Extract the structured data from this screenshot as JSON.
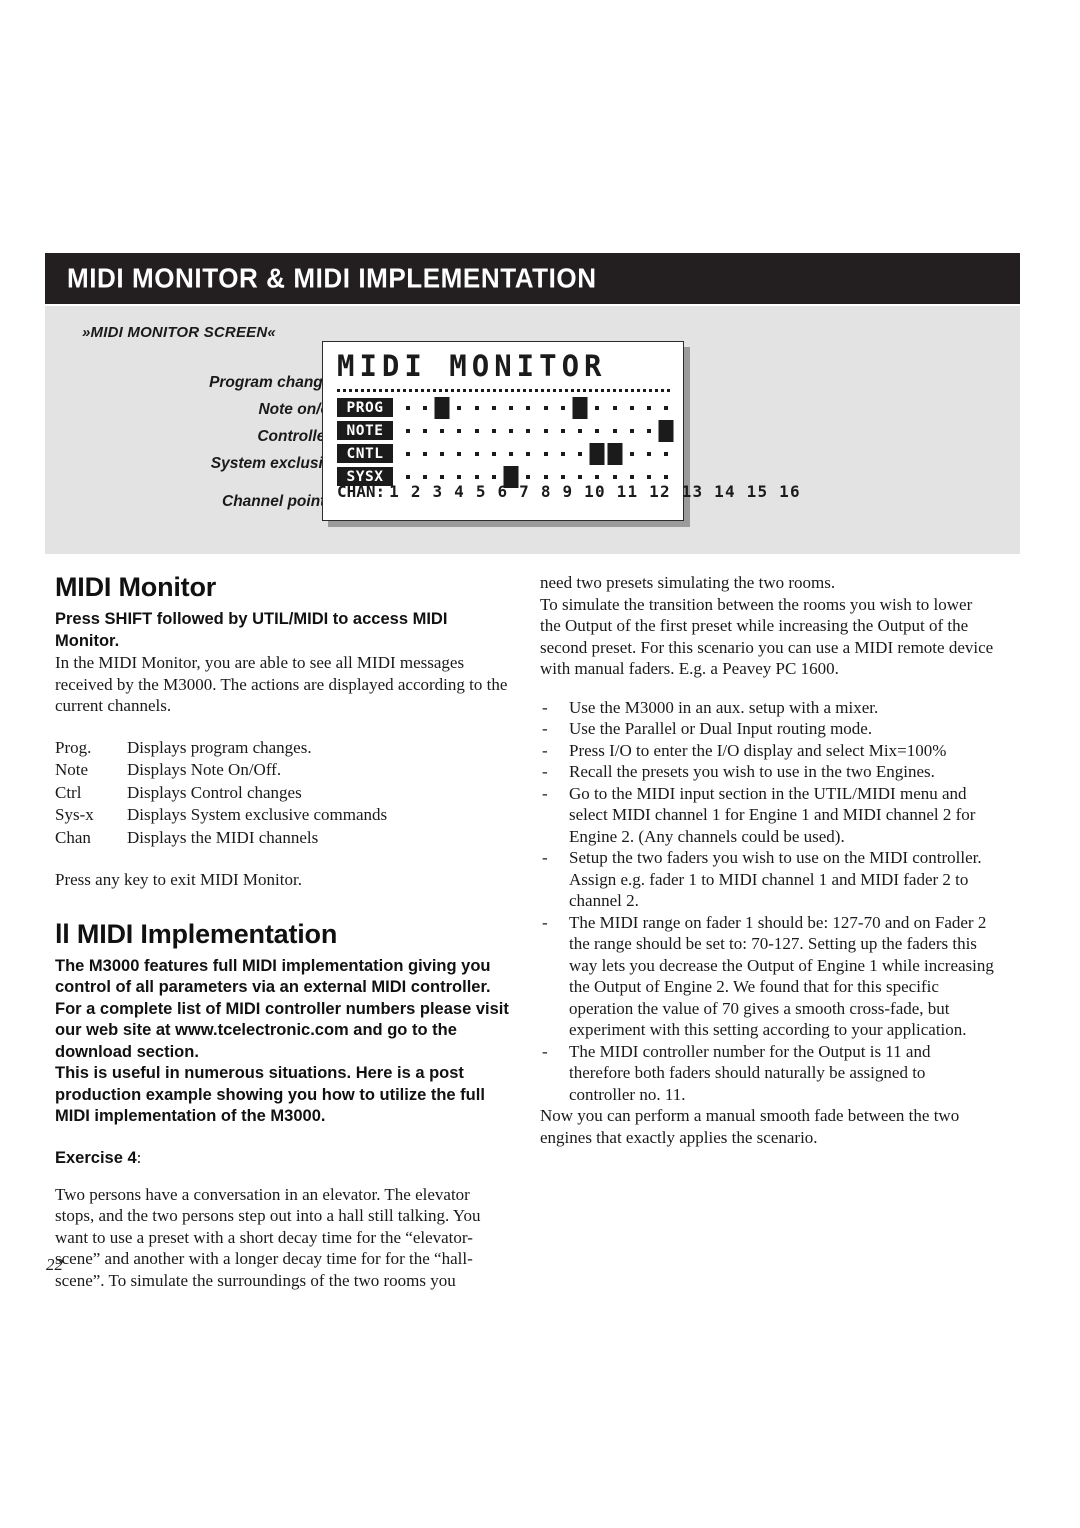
{
  "header": {
    "title": "MIDI MONITOR  &  MIDI IMPLEMENTATION",
    "background_color": "#231f20",
    "text_color": "#ffffff"
  },
  "figure": {
    "caption": "»MIDI MONITOR SCREEN«",
    "panel_color": "#e3e3e3",
    "callouts": [
      {
        "label": "Program changes",
        "target_row": "PROG"
      },
      {
        "label": "Note on/off",
        "target_row": "NOTE"
      },
      {
        "label": "Controllers",
        "target_row": "CNTL"
      },
      {
        "label": "System exclusive",
        "target_row": "SYSX"
      },
      {
        "label": "Channel pointer",
        "target_row": "CHAN"
      }
    ],
    "lcd": {
      "title": "MIDI MONITOR",
      "channel_label": "CHAN:",
      "channel_numbers": "1 2 3 4 5 6 7 8 9 10 11 12 13 14 15 16",
      "channel_count": 16,
      "rows": [
        {
          "tag": "PROG",
          "active_channels": [
            3,
            11
          ]
        },
        {
          "tag": "NOTE",
          "active_channels": [
            16
          ]
        },
        {
          "tag": "CNTL",
          "active_channels": [
            12,
            13
          ]
        },
        {
          "tag": "SYSX",
          "active_channels": [
            7
          ]
        }
      ]
    }
  },
  "left_column": {
    "heading": "MIDI Monitor",
    "intro_bold": "Press SHIFT followed by UTIL/MIDI to access MIDI Monitor.",
    "intro_body": "In the MIDI Monitor, you are able to see all MIDI messages received by the M3000. The actions are displayed according to the current channels.",
    "definitions": [
      {
        "term": "Prog.",
        "description": "Displays program changes."
      },
      {
        "term": "Note",
        "description": "Displays Note On/Off."
      },
      {
        "term": "Ctrl",
        "description": "Displays Control changes"
      },
      {
        "term": "Sys-x",
        "description": "Displays System exclusive commands"
      },
      {
        "term": "Chan",
        "description": "Displays the MIDI channels"
      }
    ],
    "exit_note": "Press any key to exit MIDI Monitor.",
    "heading2": "ll MIDI Implementation",
    "impl_bold_1": "The M3000 features full MIDI implementation giving you control of all parameters via an external MIDI controller.",
    "impl_bold_2": "For a complete list of MIDI controller numbers please visit our web site at www.tcelectronic.com and go to the download section.",
    "impl_bold_3": "This is useful in numerous situations. Here is a post production example showing you how to utilize the full MIDI implementation of the M3000.",
    "exercise_label": "Exercise 4",
    "exercise_colon": ":",
    "exercise_body": "Two persons have a conversation in an elevator. The elevator stops, and the two persons step out into a hall still talking. You want to use a preset with a short decay time for the “elevator-scene” and another with a longer decay time for for the “hall-scene”. To simulate the surroundings of the two rooms you"
  },
  "right_column": {
    "continuation": "need two presets simulating the two rooms.",
    "paragraph_1": "To simulate the transition between the rooms you wish to lower the Output of the first preset while increasing the Output of the second preset. For this scenario you can use a MIDI remote device with manual faders. E.g. a Peavey PC 1600.",
    "bullet_marker": "-",
    "bullets": [
      "Use the M3000 in an aux. setup with a mixer.",
      "Use the Parallel or Dual Input routing mode.",
      "Press I/O to enter the I/O display and select Mix=100%",
      "Recall the presets you wish to use in the two Engines.",
      "Go to the MIDI input section in the UTIL/MIDI menu and select  MIDI channel 1 for Engine 1 and  MIDI channel 2 for Engine 2. (Any channels could be used).",
      "Setup the two faders you wish to use on the MIDI controller. Assign e.g. fader 1 to MIDI channel 1 and MIDI fader 2 to channel 2.",
      "The MIDI range on fader 1 should be: 127-70 and on Fader 2 the range should be set to: 70-127. Setting up the faders this way lets you decrease the Output of Engine 1 while increasing the Output of Engine 2. We found that for this specific operation the value of 70 gives a smooth cross-fade, but experiment with this setting according to your application.",
      "The MIDI controller number for the Output is 11 and therefore both faders should naturally be assigned to controller no. 11."
    ],
    "closing": "Now you can perform a manual smooth fade between the two engines that exactly applies the scenario."
  },
  "footer": {
    "page_number": "22"
  }
}
